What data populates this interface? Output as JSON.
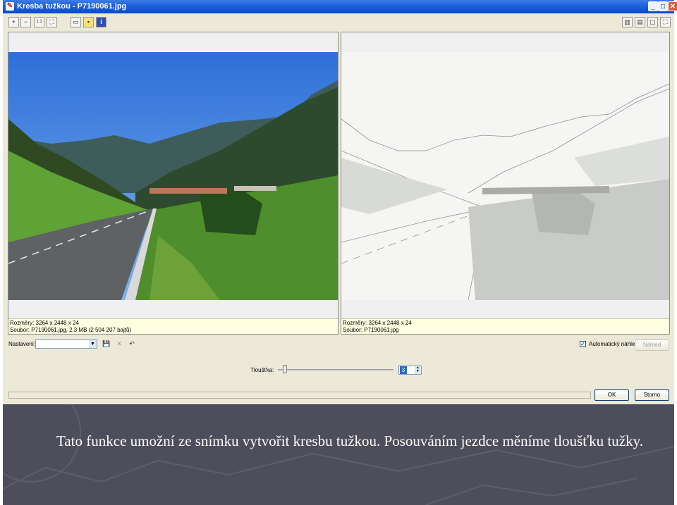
{
  "window": {
    "title": "Kresba tužkou - P7190061.jpg",
    "controls": [
      "_",
      "□",
      "✕"
    ]
  },
  "toolbar": {
    "icons": [
      "zoom-in-icon",
      "zoom-out-icon",
      "actual-size-icon",
      "fit-icon",
      "image-icon",
      "color-icon",
      "info-icon"
    ],
    "right_icons": [
      "split-vertical-icon",
      "split-horizontal-icon",
      "single-view-icon",
      "fullscreen-icon"
    ]
  },
  "left_pane": {
    "info_line1": "Rozměry: 3264 x 2448 x 24",
    "info_line2": "Soubor: P7190061.jpg, 2.3 MB (2 504 207 bajtů)"
  },
  "right_pane": {
    "info_line1": "Rozměry: 3264 x 2448 x 24",
    "info_line2": "Soubor: P7190061.jpg"
  },
  "settings": {
    "label": "Nastavení:",
    "value": ""
  },
  "auto_preview": {
    "label": "Automatický náhled",
    "checked": true
  },
  "buttons": {
    "preview": "Náhled",
    "ok": "OK",
    "cancel": "Storno"
  },
  "thickness": {
    "label": "Tloušťka:",
    "value": "3",
    "slider_fraction": 0.06
  },
  "caption": "Tato funkce umožní ze snímku vytvořit kresbu tužkou. Posouváním jezdce měníme tloušťku tužky."
}
